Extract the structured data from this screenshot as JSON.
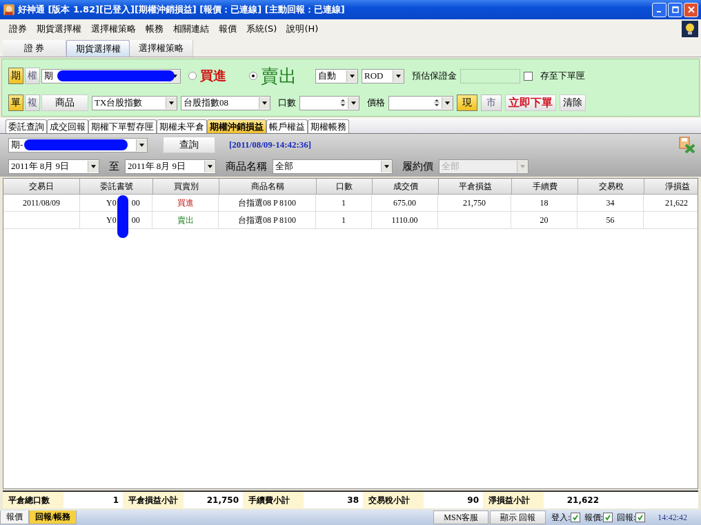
{
  "window": {
    "title": "好神通 [版本 1.82][已登入][期權沖銷損益] [報價：已連線] [主動回報：已連線]"
  },
  "menu": [
    "證券",
    "期貨選擇權",
    "選擇權策略",
    "帳務",
    "相關連結",
    "報價",
    "系統(S)",
    "說明(H)"
  ],
  "main_tabs": [
    {
      "label": "證 券",
      "selected": false
    },
    {
      "label": "期貨選擇權",
      "selected": true
    },
    {
      "label": "選擇權策略",
      "selected": false
    }
  ],
  "order_panel": {
    "market_toggle": [
      {
        "label": "期",
        "selected": true
      },
      {
        "label": "權",
        "selected": false
      }
    ],
    "account": "期",
    "sides": [
      {
        "label": "買進",
        "kind": "buy",
        "selected": false
      },
      {
        "label": "賣出",
        "kind": "sell",
        "selected": true
      }
    ],
    "condition": "自動",
    "time_in_force": "ROD",
    "margin_label": "預估保證金",
    "save_label": "存至下單匣",
    "save_checked": false,
    "leg_toggle": [
      {
        "label": "單",
        "selected": true
      },
      {
        "label": "複",
        "selected": false
      }
    ],
    "product_button": "商品",
    "product": "TX台股指數",
    "contract": "台股指數08",
    "qty_label": "口數",
    "price_label": "價格",
    "price_type": [
      {
        "label": "現",
        "selected": true
      },
      {
        "label": "市",
        "selected": false
      }
    ],
    "submit_button": "立即下單",
    "clear_button": "清除"
  },
  "sub_tabs": [
    {
      "label": "委託查詢",
      "selected": false
    },
    {
      "label": "成交回報",
      "selected": false
    },
    {
      "label": "期權下單暫存匣",
      "selected": false
    },
    {
      "label": "期權未平倉",
      "selected": false
    },
    {
      "label": "期權沖銷損益",
      "selected": true
    },
    {
      "label": "帳戶權益",
      "selected": false
    },
    {
      "label": "期權帳務",
      "selected": false
    }
  ],
  "query": {
    "account": "期-",
    "query_button": "查詢",
    "timestamp": "[2011/08/09-14:42:36]",
    "date_from": "2011年  8月  9日",
    "to_label": "至",
    "date_to": "2011年  8月  9日",
    "product_name_label": "商品名稱",
    "product_name": "全部",
    "strike_label": "履約價",
    "strike": "全部",
    "strike_disabled": true
  },
  "table": {
    "columns": [
      "交易日",
      "委託書號",
      "買賣別",
      "商品名稱",
      "口數",
      "成交價",
      "平倉損益",
      "手續費",
      "交易稅",
      "淨損益"
    ],
    "rows": [
      {
        "kind": "buy",
        "cells": [
          "2011/08/09",
          "Y0",
          "買進",
          "台指選08 P 8100",
          "1",
          "675.00",
          "21,750",
          "18",
          "34",
          "21,622"
        ],
        "order_suffix": "00"
      },
      {
        "kind": "sell",
        "cells": [
          "",
          "Y0",
          "賣出",
          "台指選08 P 8100",
          "1",
          "1110.00",
          "",
          "20",
          "56",
          ""
        ],
        "order_suffix": "00"
      }
    ]
  },
  "summary": [
    {
      "label": "平倉總口數",
      "value": "1"
    },
    {
      "label": "平倉損益小計",
      "value": "21,750"
    },
    {
      "label": "手續費小計",
      "value": "38"
    },
    {
      "label": "交易稅小計",
      "value": "90"
    },
    {
      "label": "淨損益小計",
      "value": "21,622"
    }
  ],
  "bottom_tabs": [
    {
      "label": "報價",
      "selected": false
    },
    {
      "label": "回報/帳務",
      "selected": true
    }
  ],
  "status_bar": {
    "buttons": [
      "MSN客服",
      "顯示 回報"
    ],
    "indicators": [
      {
        "label": "登入:",
        "checked": true
      },
      {
        "label": "報價:",
        "checked": true
      },
      {
        "label": "回報:",
        "checked": true
      }
    ],
    "time": "14:42:42"
  }
}
